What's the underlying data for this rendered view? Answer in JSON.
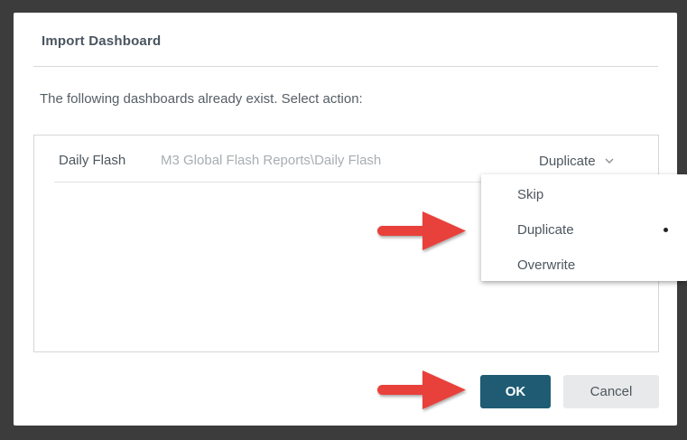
{
  "dialog": {
    "title": "Import Dashboard",
    "instructions": "The following dashboards already exist. Select action:"
  },
  "rows": [
    {
      "name": "Daily Flash",
      "path": "M3 Global Flash Reports\\Daily Flash",
      "action": "Duplicate"
    }
  ],
  "dropdown": {
    "options": [
      "Skip",
      "Duplicate",
      "Overwrite"
    ],
    "selected": "Duplicate"
  },
  "buttons": {
    "ok_label": "OK",
    "cancel_label": "Cancel"
  },
  "icons": {
    "chevron": "chevron-down-icon",
    "selected_marker": "selected-dot-icon",
    "annotation": "red-arrow-icon"
  },
  "colors": {
    "primary_button": "#1f5c74",
    "secondary_button": "#e8e9ea",
    "annotation_arrow": "#e8403a",
    "backdrop": "#3c3c3c"
  }
}
